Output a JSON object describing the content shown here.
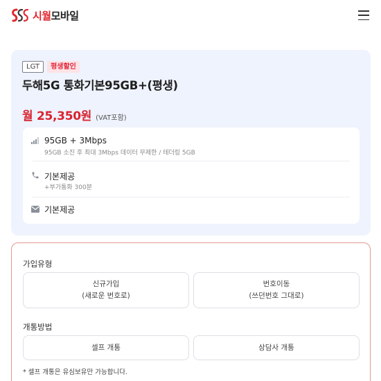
{
  "header": {
    "logo_brand": "시월",
    "logo_rest": "모바일",
    "logo_icon": "s-chain-logo-icon",
    "menu_icon": "hamburger-menu-icon"
  },
  "plan": {
    "carrier_badge": "LGT",
    "discount_badge": "평생할인",
    "name": "두해5G 통화기본95GB+(평생)",
    "price": "월 25,350원",
    "vat_note": "(VAT포함)",
    "features": [
      {
        "icon": "signal-bars-icon",
        "title": "95GB + 3Mbps",
        "sub": "95GB 소진 후 최대 3Mbps 데이터 무제한 / 테더링 5GB"
      },
      {
        "icon": "phone-icon",
        "title": "기본제공",
        "sub": "+부가통화 300분"
      },
      {
        "icon": "envelope-icon",
        "title": "기본제공",
        "sub": ""
      }
    ]
  },
  "join": {
    "type_label": "가입유형",
    "type_options": [
      {
        "line1": "신규가입",
        "line2": "(새로운 번호로)"
      },
      {
        "line1": "번호이동",
        "line2": "(쓰던번호 그대로)"
      }
    ],
    "method_label": "개통방법",
    "method_options": [
      {
        "label": "셀프 개통"
      },
      {
        "label": "상담사 개통"
      }
    ],
    "note": "* 셀프 개통은 유심보유만 가능합니다."
  },
  "colors": {
    "brand_red": "#e1262d",
    "price_red": "#d8232e",
    "card_bg": "#eef3fd",
    "join_border": "#e09a90"
  }
}
